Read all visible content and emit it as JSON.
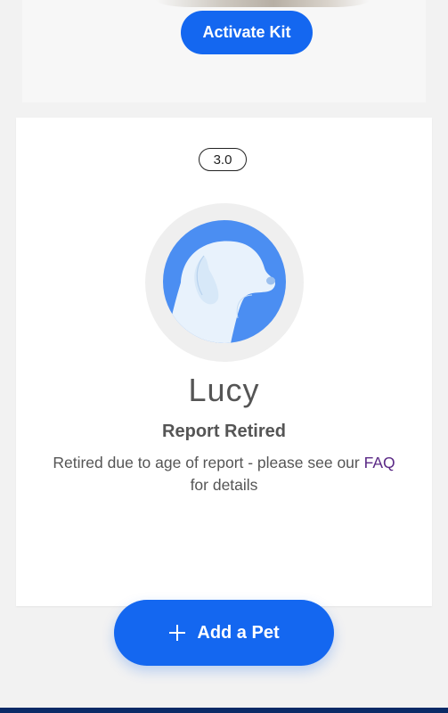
{
  "top_card": {
    "activate_label": "Activate Kit"
  },
  "pet_card": {
    "version": "3.0",
    "avatar_icon": "dog-avatar-icon",
    "name": "Lucy",
    "status_title": "Report Retired",
    "status_text_before": "Retired due to age of report - please see our ",
    "faq_link": "FAQ",
    "status_text_after": " for details"
  },
  "add_pet": {
    "label": "Add a Pet",
    "icon": "plus-icon"
  },
  "colors": {
    "primary": "#1467f0",
    "link": "#5b2a86",
    "text": "#555555",
    "background": "#f2f2f2",
    "footer": "#0a2a66"
  }
}
